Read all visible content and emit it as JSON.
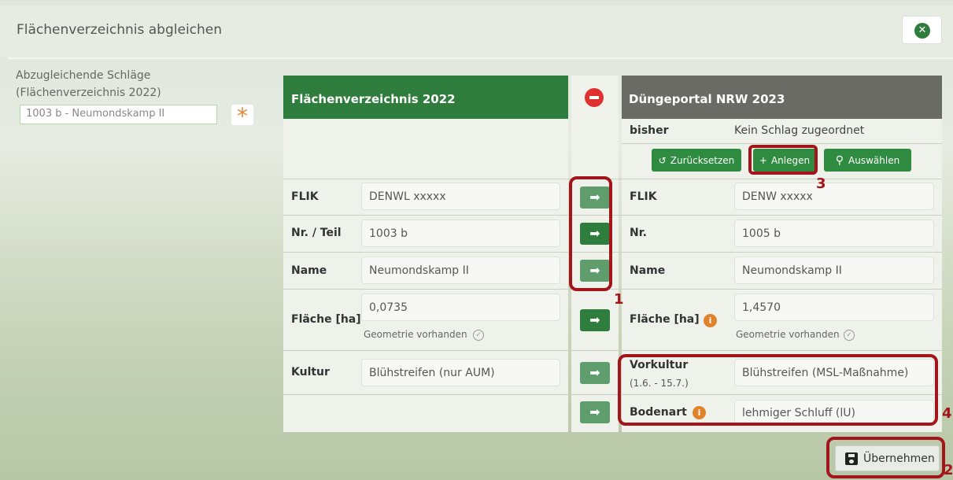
{
  "dialog": {
    "title": "Flächenverzeichnis abgleichen",
    "close_icon": "close-circle-icon"
  },
  "left": {
    "label_line1": "Abzugleichende Schläge",
    "label_line2": "(Flächenverzeichnis 2022)",
    "search_value": "1003 b - Neumondskamp II",
    "required_marker": "*"
  },
  "source": {
    "header": "Flächenverzeichnis 2022",
    "rows": {
      "flik_label": "FLIK",
      "flik_value": "DENWL  xxxxx",
      "nr_label": "Nr. / Teil",
      "nr_value": "1003 b",
      "name_label": "Name",
      "name_value": "Neumondskamp II",
      "flaeche_label": "Fläche [ha]",
      "flaeche_value": "0,0735",
      "geometrie": "Geometrie vorhanden",
      "kultur_label": "Kultur",
      "kultur_value": "Blühstreifen (nur AUM)"
    }
  },
  "target": {
    "header": "Düngeportal NRW 2023",
    "bisher_label": "bisher",
    "bisher_value": "Kein Schlag zugeordnet",
    "buttons": {
      "reset": "Zurücksetzen",
      "create": "Anlegen",
      "select": "Auswählen"
    },
    "rows": {
      "flik_label": "FLIK",
      "flik_value": "DENW  xxxxx",
      "nr_label": "Nr.",
      "nr_value": "1005 b",
      "name_label": "Name",
      "name_value": "Neumondskamp II",
      "flaeche_label": "Fläche [ha]",
      "flaeche_value": "1,4570",
      "geometrie": "Geometrie vorhanden",
      "vorkultur_label": "Vorkultur",
      "vorkultur_sub": "(1.6. - 15.7.)",
      "vorkultur_value": "Blühstreifen (MSL-Maßnahme)",
      "bodenart_label": "Bodenart",
      "bodenart_value": "lehmiger Schluff (lU)"
    }
  },
  "callouts": {
    "c1": "1",
    "c2": "2",
    "c3": "3",
    "c4": "4"
  },
  "save_button": "Übernehmen",
  "colors": {
    "green": "#2e7d3c",
    "gray_header": "#6b6b66",
    "callout": "#a4151b",
    "info": "#e0822b"
  }
}
